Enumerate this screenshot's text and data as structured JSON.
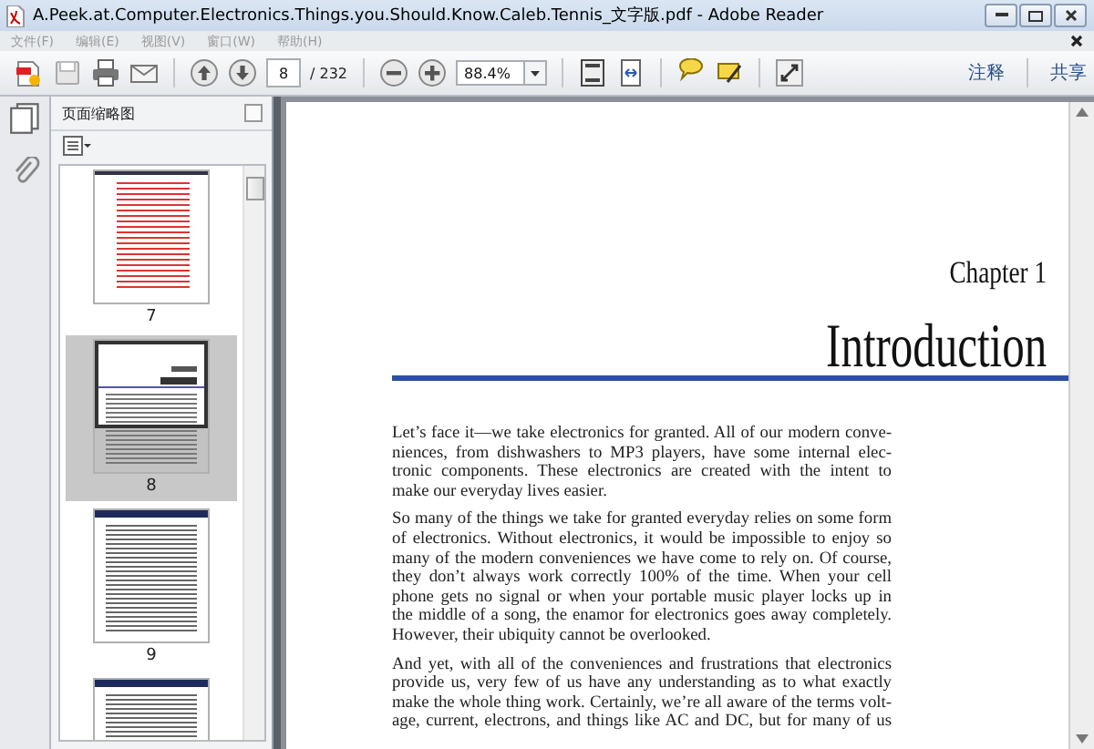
{
  "window": {
    "title": "A.Peek.at.Computer.Electronics.Things.you.Should.Know.Caleb.Tennis_文字版.pdf - Adobe Reader"
  },
  "menu": [
    {
      "label": "文件(F)",
      "disabled": true
    },
    {
      "label": "编辑(E)",
      "disabled": true
    },
    {
      "label": "视图(V)",
      "disabled": true
    },
    {
      "label": "窗口(W)",
      "disabled": true
    },
    {
      "label": "帮助(H)",
      "disabled": true
    }
  ],
  "toolbar": {
    "page": "8",
    "page_count": "/ 232",
    "zoom": "88.4%",
    "right_buttons": [
      "注释",
      "共享"
    ]
  },
  "sidebar": {
    "title": "页面缩略图",
    "pages": [
      {
        "label": "7",
        "selected": false,
        "kind": "toc"
      },
      {
        "label": "8",
        "selected": true,
        "kind": "chapter"
      },
      {
        "label": "9",
        "selected": false,
        "kind": "text"
      },
      {
        "selected": false,
        "kind": "text"
      }
    ]
  },
  "document": {
    "chapter": "Chapter 1",
    "heading": "Introduction",
    "paragraphs": [
      {
        "continues": false,
        "lines": [
          "Let’s face it—we take electronics for granted. All of our modern conve-",
          "niences, from dishwashers to MP3 players, have some internal elec-",
          "tronic components. These electronics are created with the intent to",
          "make our everyday lives easier."
        ]
      },
      {
        "continues": false,
        "lines": [
          "So many of the things we take for granted everyday relies on some form",
          "of electronics. Without electronics, it would be impossible to enjoy so",
          "many of the modern conveniences we have come to rely on. Of course,",
          "they don’t always work correctly 100% of the time. When your cell",
          "phone gets no signal or when your portable music player locks up in",
          "the middle of a song, the enamor for electronics goes away completely.",
          "However, their ubiquity cannot be overlooked."
        ]
      },
      {
        "continues": true,
        "lines": [
          "And yet, with all of the conveniences and frustrations that electronics",
          "provide us, very few of us have any understanding as to what exactly",
          "make the whole thing work. Certainly, we’re all aware of the terms volt-",
          "age, current, electrons, and things like AC and DC, but for many of us"
        ]
      }
    ]
  }
}
